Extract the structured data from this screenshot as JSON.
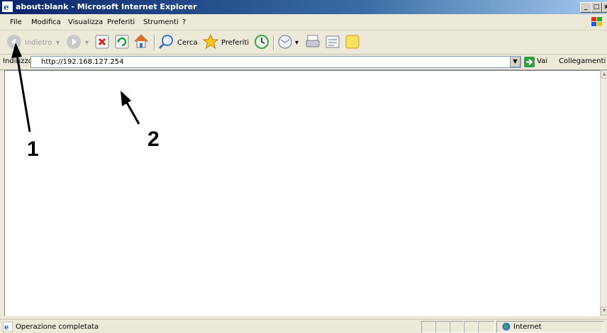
{
  "window": {
    "title": "about:blank - Microsoft Internet Explorer",
    "controls": {
      "minimize": "_",
      "maximize": "□",
      "close": "x"
    }
  },
  "menu": {
    "items": [
      "File",
      "Modifica",
      "Visualizza",
      "Preferiti",
      "Strumenti",
      "?"
    ]
  },
  "toolbar": {
    "back_label": "Indietro",
    "search_label": "Cerca",
    "favorites_label": "Preferiti"
  },
  "address": {
    "label": "Indirizzo",
    "url": "http://192.168.127.254",
    "go_label": "Vai",
    "links_label": "Collegamenti »"
  },
  "annotations": {
    "label_1": "1",
    "label_2": "2"
  },
  "status": {
    "text": "Operazione completata",
    "zone": "Internet"
  },
  "icons": {
    "app": "ie-icon",
    "back": "back-arrow-icon",
    "forward": "forward-arrow-icon",
    "stop": "stop-icon",
    "refresh": "refresh-icon",
    "home": "home-icon",
    "search": "search-icon",
    "favorites": "star-icon",
    "history": "history-icon",
    "mail": "mail-icon",
    "print": "printer-icon",
    "edit": "edit-icon",
    "messenger": "note-icon"
  }
}
